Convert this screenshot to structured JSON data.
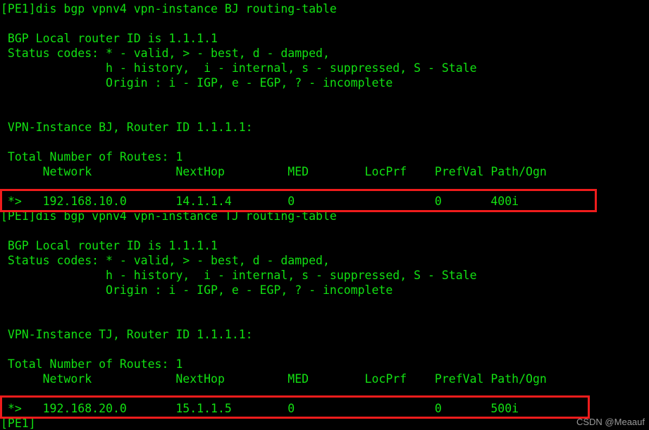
{
  "terminal": {
    "title": "BGP VPNv4 routing-table output",
    "colors": {
      "background": "#000000",
      "text": "#12e012",
      "highlight_border": "#ef1c1c",
      "watermark": "#9a9a9a"
    },
    "lines": [
      "[PE1]dis bgp vpnv4 vpn-instance BJ routing-table",
      "",
      " BGP Local router ID is 1.1.1.1",
      " Status codes: * - valid, > - best, d - damped,",
      "               h - history,  i - internal, s - suppressed, S - Stale",
      "               Origin : i - IGP, e - EGP, ? - incomplete",
      "",
      "",
      " VPN-Instance BJ, Router ID 1.1.1.1:",
      "",
      " Total Number of Routes: 1",
      "      Network            NextHop         MED        LocPrf    PrefVal Path/Ogn",
      "",
      " *>   192.168.10.0       14.1.1.4        0                    0       400i",
      "[PE1]dis bgp vpnv4 vpn-instance TJ routing-table",
      "",
      " BGP Local router ID is 1.1.1.1",
      " Status codes: * - valid, > - best, d - damped,",
      "               h - history,  i - internal, s - suppressed, S - Stale",
      "               Origin : i - IGP, e - EGP, ? - incomplete",
      "",
      "",
      " VPN-Instance TJ, Router ID 1.1.1.1:",
      "",
      " Total Number of Routes: 1",
      "      Network            NextHop         MED        LocPrf    PrefVal Path/Ogn",
      "",
      " *>   192.168.20.0       15.1.1.5        0                    0       500i",
      "[PE1]"
    ],
    "commands": [
      {
        "prompt": "[PE1]",
        "command": "dis bgp vpnv4 vpn-instance BJ routing-table"
      },
      {
        "prompt": "[PE1]",
        "command": "dis bgp vpnv4 vpn-instance TJ routing-table"
      }
    ],
    "final_prompt": "[PE1]",
    "sections": [
      {
        "router_id_line": " BGP Local router ID is 1.1.1.1",
        "status_codes_label": " Status codes: * - valid, > - best, d - damped,",
        "status_codes_line2": "               h - history,  i - internal, s - suppressed, S - Stale",
        "origin_line": "               Origin : i - IGP, e - EGP, ? - incomplete",
        "vpn_instance_line": " VPN-Instance BJ, Router ID 1.1.1.1:",
        "total_routes_line": " Total Number of Routes: 1",
        "vpn_instance_name": "BJ",
        "router_id": "1.1.1.1",
        "total_routes": "1",
        "columns": [
          "Network",
          "NextHop",
          "MED",
          "LocPrf",
          "PrefVal",
          "Path/Ogn"
        ],
        "header_line": "      Network            NextHop         MED        LocPrf    PrefVal Path/Ogn",
        "route_line": " *>   192.168.10.0       14.1.1.4        0                    0       400i",
        "route": {
          "status": "*>",
          "network": "192.168.10.0",
          "nexthop": "14.1.1.4",
          "med": "0",
          "locprf": "",
          "prefval": "0",
          "path_ogn": "400i"
        }
      },
      {
        "router_id_line": " BGP Local router ID is 1.1.1.1",
        "status_codes_label": " Status codes: * - valid, > - best, d - damped,",
        "status_codes_line2": "               h - history,  i - internal, s - suppressed, S - Stale",
        "origin_line": "               Origin : i - IGP, e - EGP, ? - incomplete",
        "vpn_instance_line": " VPN-Instance TJ, Router ID 1.1.1.1:",
        "total_routes_line": " Total Number of Routes: 1",
        "vpn_instance_name": "TJ",
        "router_id": "1.1.1.1",
        "total_routes": "1",
        "columns": [
          "Network",
          "NextHop",
          "MED",
          "LocPrf",
          "PrefVal",
          "Path/Ogn"
        ],
        "header_line": "      Network            NextHop         MED        LocPrf    PrefVal Path/Ogn",
        "route_line": " *>   192.168.20.0       15.1.1.5        0                    0       500i",
        "route": {
          "status": "*>",
          "network": "192.168.20.0",
          "nexthop": "15.1.1.5",
          "med": "0",
          "locprf": "",
          "prefval": "0",
          "path_ogn": "500i"
        }
      }
    ]
  },
  "watermark": {
    "text": "CSDN @Meaauf"
  }
}
